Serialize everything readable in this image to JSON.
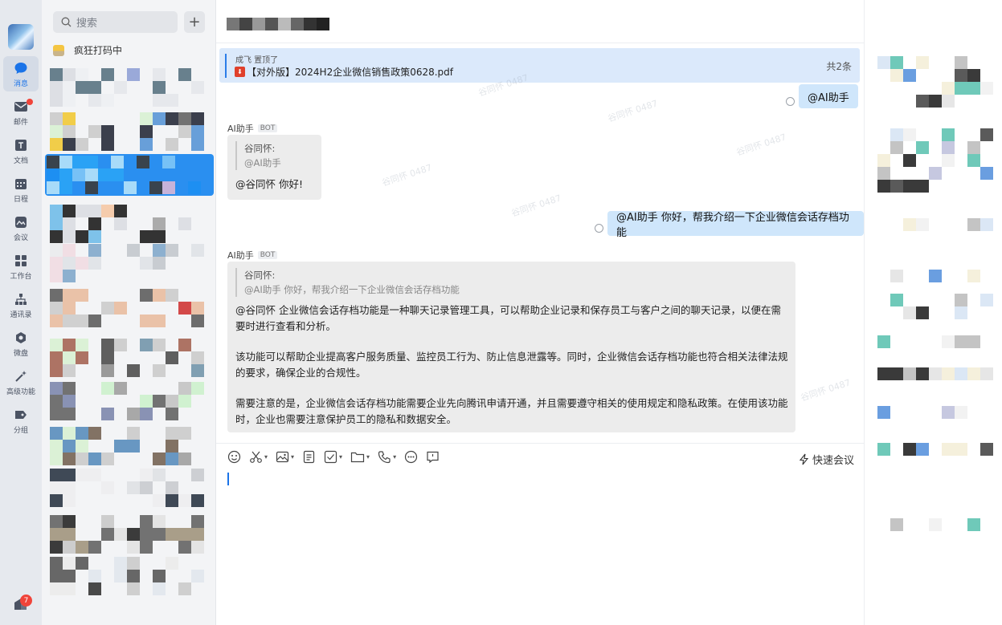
{
  "rail": {
    "items": [
      {
        "label": "消息",
        "icon": "message-icon",
        "active": true
      },
      {
        "label": "邮件",
        "icon": "mail-icon",
        "active": false
      },
      {
        "label": "文档",
        "icon": "document-icon",
        "active": false
      },
      {
        "label": "日程",
        "icon": "calendar-icon",
        "active": false
      },
      {
        "label": "会议",
        "icon": "meeting-icon",
        "active": false
      },
      {
        "label": "工作台",
        "icon": "workbench-icon",
        "active": false
      },
      {
        "label": "通讯录",
        "icon": "contacts-icon",
        "active": false
      },
      {
        "label": "微盘",
        "icon": "drive-icon",
        "active": false
      },
      {
        "label": "高级功能",
        "icon": "advanced-icon",
        "active": false
      },
      {
        "label": "分组",
        "icon": "group-icon",
        "active": false
      }
    ],
    "bottom_badge": "7"
  },
  "sessions": {
    "search_placeholder": "搜索",
    "add_label": "+",
    "status_text": "疯狂打码中"
  },
  "chat": {
    "pinned": {
      "who": "成飞 置顶了",
      "file_name": "【对外版】2024H2企业微信销售政策0628.pdf",
      "count": "共2条"
    },
    "messages": {
      "out1": "@AI助手",
      "bot1_sender": "AI助手",
      "bot_tag": "BOT",
      "bot1_quote_name": "谷同怀:",
      "bot1_quote_text": "@AI助手",
      "bot1_text": "@谷同怀  你好!",
      "out2": "@AI助手 你好，帮我介绍一下企业微信会话存档功能",
      "bot2_sender": "AI助手",
      "bot2_quote_name": "谷同怀:",
      "bot2_quote_text": "@AI助手 你好，帮我介绍一下企业微信会话存档功能",
      "bot2_p1a": " @谷同怀  企业微信会话存档功能是一种聊天记录管理工具，可以帮助企业记录和保存员工与客户之间的聊天记录，以便在需",
      "bot2_p1b": "要时进行查看和分析。",
      "bot2_p2a": "该功能可以帮助企业提高客户服务质量、监控员工行为、防止信息泄露等。同时，企业微信会话存档功能也符合相关法律法规",
      "bot2_p2b": "的要求，确保企业的合规性。",
      "bot2_p3a": "需要注意的是，企业微信会话存档功能需要企业先向腾讯申请开通，并且需要遵守相关的使用规定和隐私政策。在使用该功能",
      "bot2_p3b": "时，企业也需要注意保护员工的隐私和数据安全。"
    },
    "watermark": "谷同怀 0487",
    "composer": {
      "quick_meeting": "快速会议"
    }
  },
  "colors": {
    "accent": "#1a73e8",
    "out_bubble": "#cfe6fb",
    "in_bubble": "#ececec",
    "pinned_bg": "#dbe9fb"
  }
}
